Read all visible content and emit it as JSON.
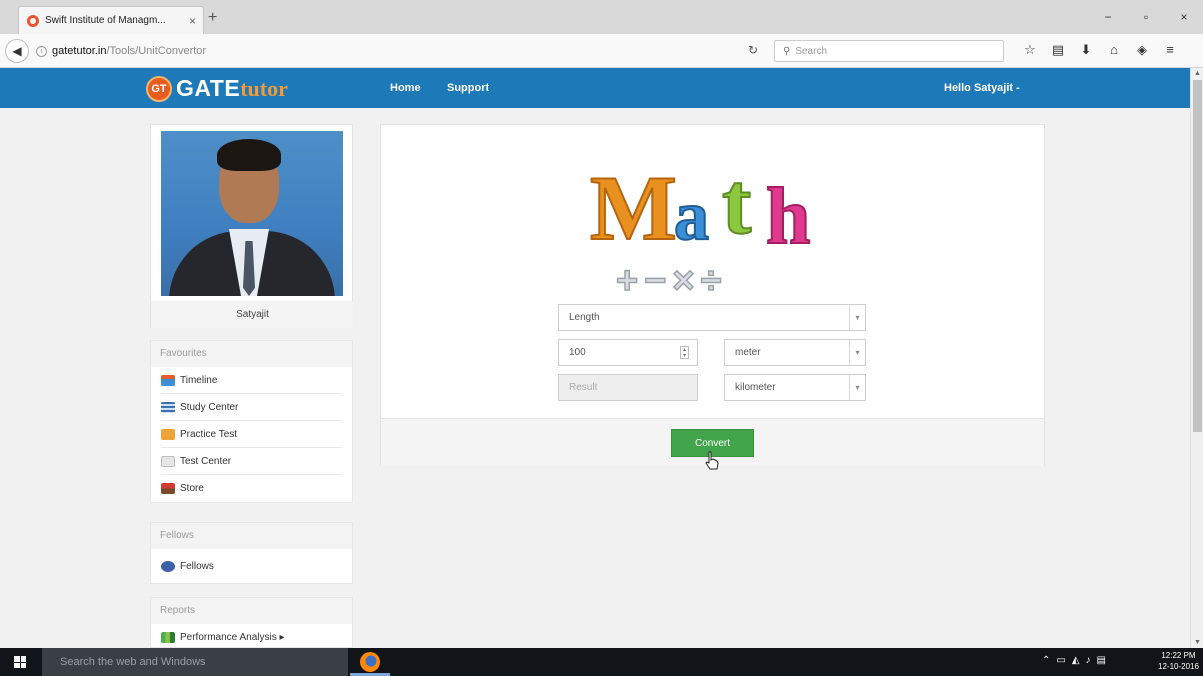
{
  "browser": {
    "tab_title": "Swift Institute of Managm...",
    "tab_close": "×",
    "new_tab": "+",
    "url_host": "gatetutor.in",
    "url_path": "/Tools/UnitConvertor",
    "search_placeholder": "Search",
    "window_controls": [
      "−",
      "▫",
      "×"
    ],
    "toolbar_icons": [
      "star-icon",
      "reading-list-icon",
      "download-icon",
      "home-icon",
      "pocket-icon",
      "menu-icon"
    ]
  },
  "site": {
    "logo_badge": "GT",
    "logo_gate": "GATE",
    "logo_tutor": "tutor",
    "nav": {
      "home": "Home",
      "support": "Support"
    },
    "user_greeting": "Hello Satyajit -",
    "header_color": "#1d79b8"
  },
  "sidebar": {
    "profile_name": "Satyajit",
    "favourites": {
      "heading": "Favourites",
      "items": [
        {
          "label": "Timeline",
          "icon": "timeline-icon"
        },
        {
          "label": "Study Center",
          "icon": "study-center-icon"
        },
        {
          "label": "Practice Test",
          "icon": "practice-test-icon"
        },
        {
          "label": "Test Center",
          "icon": "test-center-icon"
        },
        {
          "label": "Store",
          "icon": "store-icon"
        }
      ]
    },
    "fellows": {
      "heading": "Fellows",
      "items": [
        {
          "label": "Fellows",
          "icon": "fellows-icon"
        }
      ]
    },
    "reports": {
      "heading": "Reports",
      "items": [
        {
          "label": "Performance Analysis ▸",
          "icon": "chart-icon"
        }
      ]
    }
  },
  "converter": {
    "math_logo_text": "Math",
    "math_logo_symbols": "+ − × ÷",
    "category": "Length",
    "input_value": "100",
    "from_unit": "meter",
    "result_placeholder": "Result",
    "to_unit": "kilometer",
    "convert_label": "Convert",
    "button_color": "#42a44b"
  },
  "taskbar": {
    "search_placeholder": "Search the web and Windows",
    "time": "12:22 PM",
    "date": "12-10-2016"
  }
}
